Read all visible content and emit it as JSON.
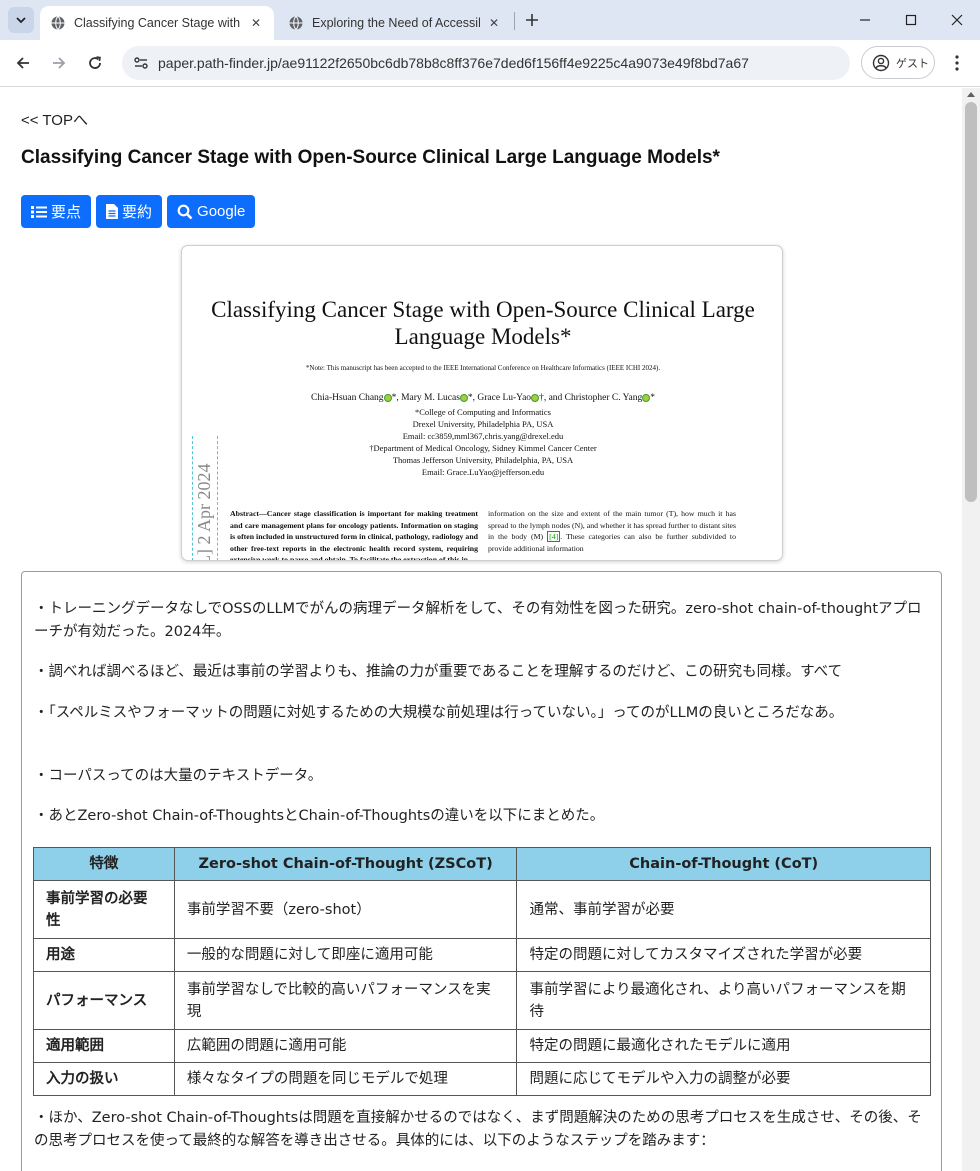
{
  "browser": {
    "tabs": [
      {
        "title": "Classifying Cancer Stage with Open-Source Clinical Large Language Models*",
        "active": true
      },
      {
        "title": "Exploring the Need of Accessibility Education",
        "active": false
      }
    ],
    "url": "paper.path-finder.jp/ae91122f2650bc6db78b8c8ff376e7ded6f156ff4e9225c4a9073e49f8bd7a67",
    "profile_label": "ゲスト"
  },
  "page": {
    "top_link": "<< TOPへ",
    "title": "Classifying Cancer Stage with Open-Source Clinical Large Language Models*",
    "buttons": [
      "要点",
      "要約",
      "Google"
    ]
  },
  "paper_preview": {
    "title": "Classifying Cancer Stage with Open-Source Clinical Large Language Models*",
    "note": "*Note: This manuscript has been accepted to the IEEE International Conference on Healthcare Informatics (IEEE ICHI 2024).",
    "authors": [
      "Chia-Hsuan Chang",
      "Mary M. Lucas",
      "Grace Lu-Yao",
      "and Christopher C. Yang"
    ],
    "affiliations": [
      "*College of Computing and Informatics",
      "Drexel University, Philadelphia PA, USA",
      "Email: cc3859,mml367,chris.yang@drexel.edu",
      "†Department of Medical Oncology, Sidney Kimmel Cancer Center",
      "Thomas Jefferson University, Philadelphia, PA, USA",
      "Email: Grace.LuYao@jefferson.edu"
    ],
    "arxiv_stamp": "L]  2 Apr 2024",
    "abstract_left": "Abstract—Cancer stage classification is important for making treatment and care management plans for oncology patients. Information on staging is often included in unstructured form in clinical, pathology, radiology and other free-text reports in the electronic health record system, requiring extensive work to parse and obtain. To facilitate the extraction of this in",
    "abstract_right_a": "information on the size and extent of the main tumor (T), how much it has spread to the lymph nodes (N), and whether it has spread further to distant sites in the body (M) ",
    "abstract_right_cite": "[4]",
    "abstract_right_b": ". These categories can also be further subdivided to provide additional information"
  },
  "notes": {
    "p1": "・トレーニングデータなしでOSSのLLMでがんの病理データ解析をして、その有効性を図った研究。zero-shot chain-of-thoughtアプローチが有効だった。2024年。",
    "p2": "・調べれば調べるほど、最近は事前の学習よりも、推論の力が重要であることを理解するのだけど、この研究も同様。すべて",
    "p3": "・「スペルミスやフォーマットの問題に対処するための大規模な前処理は行っていない。」ってのがLLMの良いところだなあ。",
    "p4": "・コーパスってのは大量のテキストデータ。",
    "p5": "・あとZero-shot Chain-of-ThoughtsとChain-of-Thoughtsの違いを以下にまとめた。",
    "p6": "・ほか、Zero-shot Chain-of-Thoughtsは問題を直接解かせるのではなく、まず問題解決のための思考プロセスを生成させ、その後、その思考プロセスを使って最終的な解答を導き出させる。具体的には、以下のようなステップを踏みます："
  },
  "comparison_table": {
    "headers": [
      "特徴",
      "Zero-shot Chain-of-Thought (ZSCoT)",
      "Chain-of-Thought (CoT)"
    ],
    "rows": [
      [
        "事前学習の必要性",
        "事前学習不要（zero-shot）",
        "通常、事前学習が必要"
      ],
      [
        "用途",
        "一般的な問題に対して即座に適用可能",
        "特定の問題に対してカスタマイズされた学習が必要"
      ],
      [
        "パフォーマンス",
        "事前学習なしで比較的高いパフォーマンスを実現",
        "事前学習により最適化され、より高いパフォーマンスを期待"
      ],
      [
        "適用範囲",
        "広範囲の問題に適用可能",
        "特定の問題に最適化されたモデルに適用"
      ],
      [
        "入力の扱い",
        "様々なタイプの問題を同じモデルで処理",
        "問題に応じてモデルや入力の調整が必要"
      ]
    ]
  }
}
